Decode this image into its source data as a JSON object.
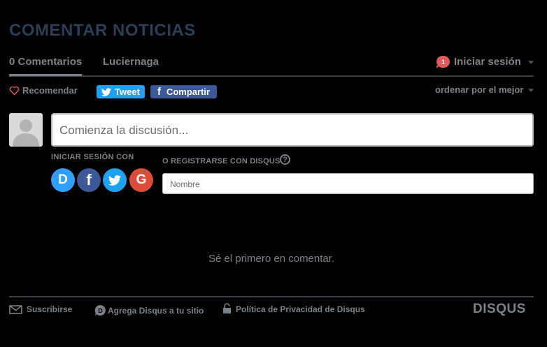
{
  "page_title": "COMENTAR NOTICIAS",
  "nav": {
    "count_tab": "0 Comentarios",
    "forum_tab": "Luciernaga",
    "notification_count": "1",
    "login": "Iniciar sesión"
  },
  "actions": {
    "recommend": "Recomendar",
    "tweet": "Tweet",
    "share": "Compartir",
    "sort": "ordenar por el mejor"
  },
  "composer": {
    "placeholder": "Comienza la discusión...",
    "login_with": "INICIAR SESIÓN CON",
    "or_register": "O REGISTRARSE CON DISQUS",
    "help": "?",
    "name_placeholder": "Nombre",
    "social": {
      "disqus": "D",
      "facebook": "f",
      "google": "G"
    }
  },
  "empty_state": "Sé el primero en comentar.",
  "footer": {
    "subscribe": "Suscribirse",
    "add_disqus": "Agrega Disqus a tu sitio",
    "privacy": "Política de Privacidad de Disqus",
    "brand": "DISQUS"
  },
  "colors": {
    "title": "#2a3f55",
    "notification": "#e05a5a",
    "twitter": "#1da1f2",
    "facebook": "#3b5998",
    "google": "#dd4b39",
    "disqus": "#2e9fff"
  }
}
